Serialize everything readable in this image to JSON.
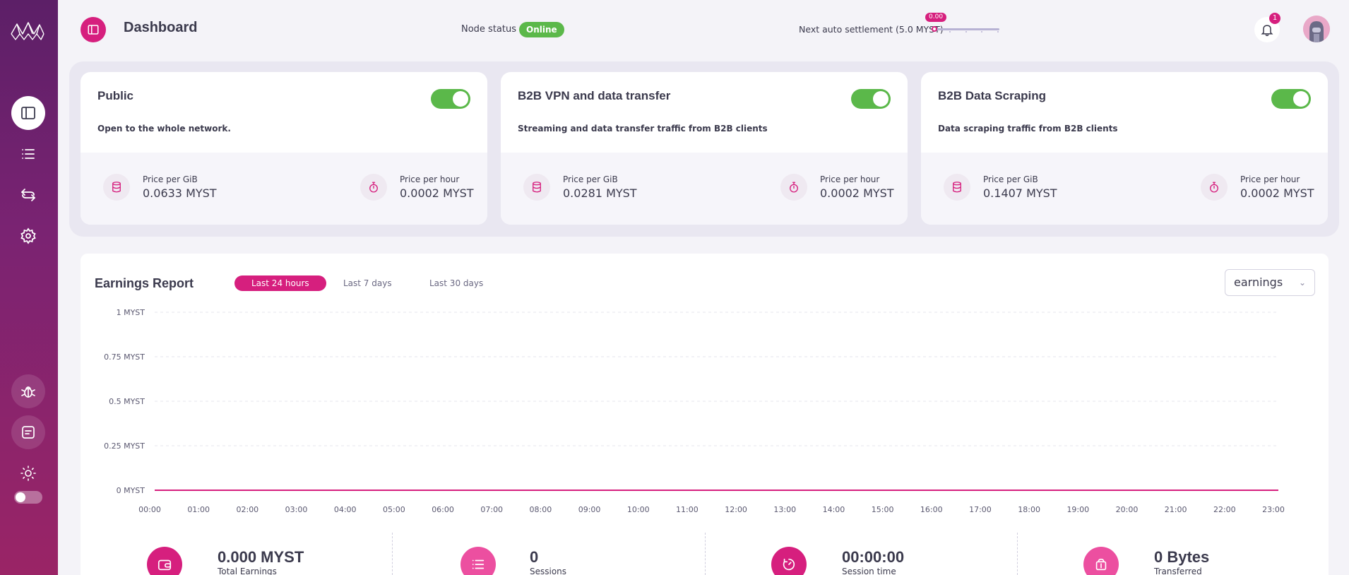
{
  "header": {
    "title": "Dashboard",
    "node_status_label": "Node status",
    "node_status_value": "Online",
    "settlement_label": "Next auto settlement (5.0 MYST)",
    "settlement_value": "0.00",
    "settlement_progress": 0,
    "notification_count": "1"
  },
  "colors": {
    "accent": "#d61f7e",
    "success": "#5bb84a",
    "sidebar": "#7a2372"
  },
  "services": [
    {
      "title": "Public",
      "description": "Open to the whole network.",
      "enabled": true,
      "price_gib_label": "Price per GiB",
      "price_gib": "0.0633 MYST",
      "price_hour_label": "Price per hour",
      "price_hour": "0.0002 MYST"
    },
    {
      "title": "B2B VPN and data transfer",
      "description": "Streaming and data transfer traffic from B2B clients",
      "enabled": true,
      "price_gib_label": "Price per GiB",
      "price_gib": "0.0281 MYST",
      "price_hour_label": "Price per hour",
      "price_hour": "0.0002 MYST"
    },
    {
      "title": "B2B Data Scraping",
      "description": "Data scraping traffic from B2B clients",
      "enabled": true,
      "price_gib_label": "Price per GiB",
      "price_gib": "0.1407 MYST",
      "price_hour_label": "Price per hour",
      "price_hour": "0.0002 MYST"
    }
  ],
  "earnings": {
    "title": "Earnings Report",
    "ranges": [
      "Last 24 hours",
      "Last 7 days",
      "Last 30 days"
    ],
    "active_range": 0,
    "metric": "earnings"
  },
  "chart_data": {
    "type": "line",
    "title": "Earnings Report",
    "x": [
      "00:00",
      "01:00",
      "02:00",
      "03:00",
      "04:00",
      "05:00",
      "06:00",
      "07:00",
      "08:00",
      "09:00",
      "10:00",
      "11:00",
      "12:00",
      "13:00",
      "14:00",
      "15:00",
      "16:00",
      "17:00",
      "18:00",
      "19:00",
      "20:00",
      "21:00",
      "22:00",
      "23:00"
    ],
    "series": [
      {
        "values": [
          0,
          0,
          0,
          0,
          0,
          0,
          0,
          0,
          0,
          0,
          0,
          0,
          0,
          0,
          0,
          0,
          0,
          0,
          0,
          0,
          0,
          0,
          0,
          0
        ]
      }
    ],
    "y_ticks": [
      {
        "value": 0,
        "label": "0 MYST"
      },
      {
        "value": 0.25,
        "label": "0.25 MYST"
      },
      {
        "value": 0.5,
        "label": "0.5 MYST"
      },
      {
        "value": 0.75,
        "label": "0.75 MYST"
      },
      {
        "value": 1,
        "label": "1 MYST"
      }
    ],
    "ylim": [
      0,
      1
    ],
    "grid": true,
    "xlabel": "",
    "ylabel": ""
  },
  "stats": [
    {
      "value": "0.000 MYST",
      "label": "Total Earnings",
      "icon": "wallet-icon"
    },
    {
      "value": "0",
      "label": "Sessions",
      "icon": "list-icon"
    },
    {
      "value": "00:00:00",
      "label": "Session time",
      "icon": "timer-icon"
    },
    {
      "value": "0 Bytes",
      "label": "Transferred",
      "icon": "transfer-icon"
    }
  ]
}
